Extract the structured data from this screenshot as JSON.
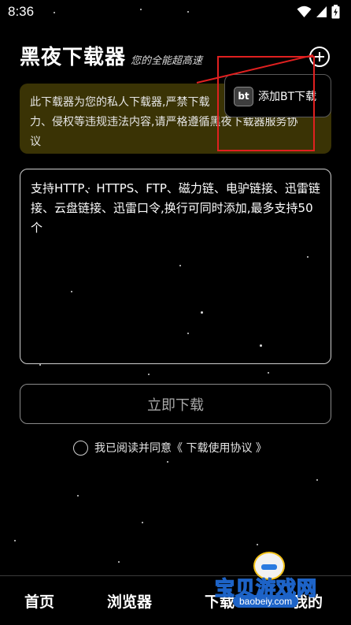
{
  "status": {
    "time": "8:36"
  },
  "header": {
    "title": "黑夜下载器",
    "subtitle": "您的全能超高速",
    "add_icon": "plus-circle-icon"
  },
  "notice": {
    "line1": "此下载器为您的私人下载器,严禁下载",
    "line2": "力、侵权等违规违法内容,请严格遵循黑夜下载器服务协",
    "line3": "议"
  },
  "popup": {
    "icon_label": "bt",
    "label": "添加BT下载"
  },
  "input": {
    "placeholder": "支持HTTP、HTTPS、FTP、磁力链、电驴链接、迅雷链接、云盘链接、迅雷口令,换行可同时添加,最多支持50个"
  },
  "download_button": {
    "label": "立即下载"
  },
  "agreement": {
    "text": "我已阅读并同意《 下载使用协议 》"
  },
  "nav": {
    "home": "首页",
    "browser": "浏览器",
    "download": "下载",
    "mine": "我的"
  },
  "watermark": {
    "text": "宝贝游戏网",
    "url": "baobeiy.com"
  },
  "colors": {
    "background": "#000000",
    "notice_bg": "#3a3305",
    "annotation": "#e02020",
    "watermark_blue": "#1d63c7"
  }
}
